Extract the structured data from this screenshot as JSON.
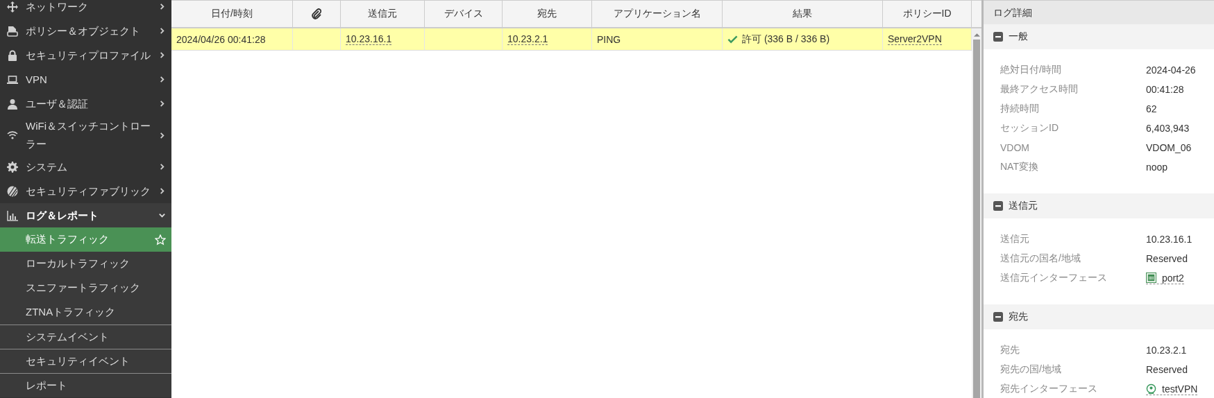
{
  "sidebar": {
    "items": [
      {
        "label": "ネットワーク",
        "expanded": false
      },
      {
        "label": "ポリシー＆オブジェクト",
        "expanded": false
      },
      {
        "label": "セキュリティプロファイル",
        "expanded": false
      },
      {
        "label": "VPN",
        "expanded": false
      },
      {
        "label": "ユーザ＆認証",
        "expanded": false
      },
      {
        "label": "WiFi＆スイッチコントローラー",
        "expanded": false
      },
      {
        "label": "システム",
        "expanded": false
      },
      {
        "label": "セキュリティファブリック",
        "expanded": false
      },
      {
        "label": "ログ＆レポート",
        "expanded": true,
        "children": [
          {
            "label": "転送トラフィック",
            "selected": true,
            "kind": "plain"
          },
          {
            "label": "ローカルトラフィック",
            "selected": false,
            "kind": "plain"
          },
          {
            "label": "スニファートラフィック",
            "selected": false,
            "kind": "plain"
          },
          {
            "label": "ZTNAトラフィック",
            "selected": false,
            "kind": "plain"
          },
          {
            "label": "システムイベント",
            "selected": false,
            "kind": "separated"
          },
          {
            "label": "セキュリティイベント",
            "selected": false,
            "kind": "separated"
          },
          {
            "label": "レポート",
            "selected": false,
            "kind": "separated"
          }
        ]
      }
    ]
  },
  "table": {
    "columns": [
      {
        "kind": "text",
        "label": "日付/時刻"
      },
      {
        "kind": "attachment"
      },
      {
        "kind": "text",
        "label": "送信元"
      },
      {
        "kind": "text",
        "label": "デバイス"
      },
      {
        "kind": "text",
        "label": "宛先"
      },
      {
        "kind": "text",
        "label": "アプリケーション名"
      },
      {
        "kind": "text",
        "label": "結果"
      },
      {
        "kind": "text",
        "label": "ポリシーID"
      }
    ],
    "rows": [
      {
        "selected": true,
        "cells": [
          {
            "kind": "text",
            "text": "2024/04/26 00:41:28"
          },
          null,
          {
            "kind": "link",
            "text": "10.23.16.1"
          },
          null,
          {
            "kind": "link",
            "text": "10.23.2.1"
          },
          {
            "kind": "text",
            "text": "PING"
          },
          {
            "kind": "allowed",
            "text": "許可 (336 B / 336 B)"
          },
          {
            "kind": "link",
            "text": "Server2VPN"
          }
        ]
      }
    ]
  },
  "details": {
    "title": "ログ詳細",
    "sections": [
      {
        "title": "一般",
        "expanded": true,
        "rows": [
          {
            "label": "絶対日付/時間",
            "value": "2024-04-26",
            "kind": "text"
          },
          {
            "label": "最終アクセス時間",
            "value": "00:41:28",
            "kind": "text"
          },
          {
            "label": "持続時間",
            "value": "62",
            "kind": "text"
          },
          {
            "label": "セッションID",
            "value": "6,403,943",
            "kind": "text"
          },
          {
            "label": "VDOM",
            "value": "VDOM_06",
            "kind": "text"
          },
          {
            "label": "NAT変換",
            "value": "noop",
            "kind": "text"
          }
        ]
      },
      {
        "title": "送信元",
        "expanded": true,
        "rows": [
          {
            "label": "送信元",
            "value": "10.23.16.1",
            "kind": "text"
          },
          {
            "label": "送信元の国名/地域",
            "value": "Reserved",
            "kind": "text"
          },
          {
            "label": "送信元インターフェース",
            "value": "port2",
            "kind": "port"
          }
        ]
      },
      {
        "title": "宛先",
        "expanded": true,
        "rows": [
          {
            "label": "宛先",
            "value": "10.23.2.1",
            "kind": "text"
          },
          {
            "label": "宛先の国/地域",
            "value": "Reserved",
            "kind": "text"
          },
          {
            "label": "宛先インターフェース",
            "value": "testVPN",
            "kind": "tunnel"
          }
        ]
      }
    ]
  }
}
